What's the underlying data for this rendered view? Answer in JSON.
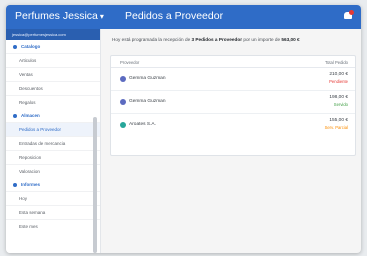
{
  "topbar": {
    "brand": "Perfumes Jessica",
    "brand_chevron": "▾",
    "page_title": "Pedidos a Proveedor",
    "bell_icon": "bell-icon"
  },
  "sidebar": {
    "email": "jessica@perfumesjessica.com",
    "sections": [
      {
        "label": "Catalogo",
        "items": [
          "Articulos",
          "Ventas",
          "Descuentos",
          "Regalos"
        ]
      },
      {
        "label": "Almacen",
        "items": [
          "Pedidos a Proveedor",
          "Entradas de mercancia",
          "Reposicion",
          "Valoracion"
        ]
      },
      {
        "label": "Informes",
        "items": [
          "Hoy",
          "Esta semana",
          "Este mes"
        ]
      }
    ]
  },
  "main": {
    "intro": {
      "prefix": "Hoy está programada la recepción de",
      "count": "3 Pedidos a Proveedor",
      "middle": "por un importe de",
      "total": "563,00 €"
    },
    "table": {
      "col_provider": "Proveedor",
      "col_total": "Total Pedido",
      "rows": [
        {
          "provider": "Gemma Guzman",
          "amount": "210,00 €",
          "status": "Pendiente",
          "status_color": "#e53935",
          "avatar_color": "#5c6bc0"
        },
        {
          "provider": "Gemma Guzman",
          "amount": "198,00 €",
          "status": "Servido",
          "status_color": "#43a047",
          "avatar_color": "#5c6bc0"
        },
        {
          "provider": "Aroates S.A.",
          "amount": "155,00 €",
          "status": "Serv. Parcial",
          "status_color": "#fb8c00",
          "avatar_color": "#26a69a"
        }
      ]
    }
  },
  "colors": {
    "accent": "#2f6cc7",
    "background": "#f5f5f5"
  }
}
